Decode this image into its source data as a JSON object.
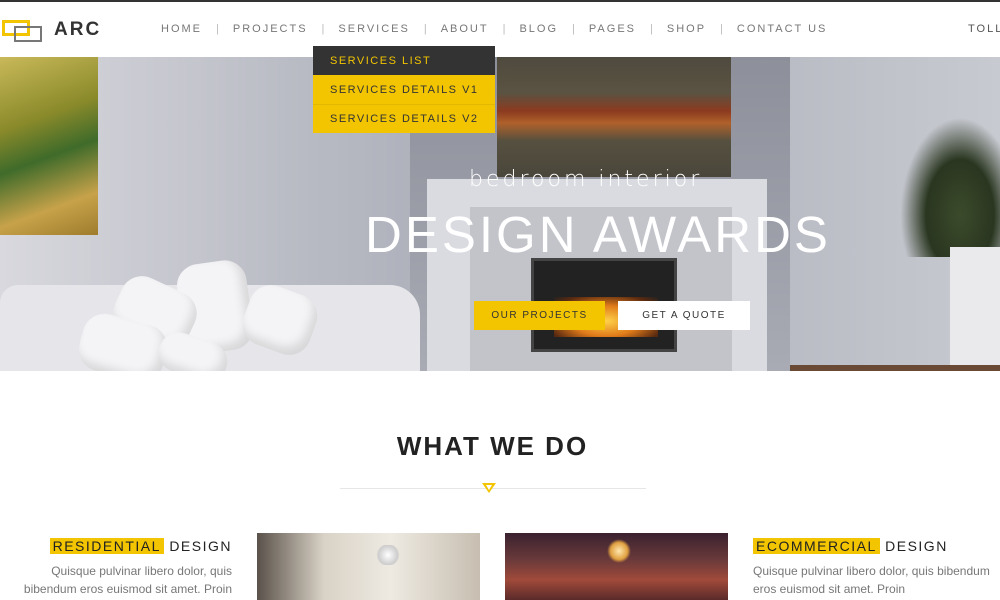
{
  "logo": {
    "text": "ARC"
  },
  "nav": {
    "items": [
      "HOME",
      "PROJECTS",
      "SERVICES",
      "ABOUT",
      "BLOG",
      "PAGES",
      "SHOP",
      "CONTACT US"
    ],
    "separator": "|",
    "toll": "TOLL"
  },
  "dropdown": {
    "items": [
      "SERVICES LIST",
      "SERVICES DETAILS V1",
      "SERVICES DETAILS V2"
    ]
  },
  "hero": {
    "subtitle": "bedroom interior",
    "title": "DESIGN AWARDS",
    "primary_button": "OUR PROJECTS",
    "secondary_button": "GET A QUOTE"
  },
  "what_we_do": {
    "title": "WHAT WE DO",
    "services": [
      {
        "highlight": "RESIDENTIAL",
        "rest": "DESIGN",
        "text": "Quisque pulvinar libero dolor, quis bibendum eros euismod sit amet. Proin"
      },
      {
        "highlight": "ECOMMERCIAL",
        "rest": "DESIGN",
        "text": "Quisque pulvinar libero dolor, quis bibendum eros euismod sit amet. Proin"
      }
    ]
  },
  "colors": {
    "accent": "#f2c500",
    "dark": "#333333"
  }
}
